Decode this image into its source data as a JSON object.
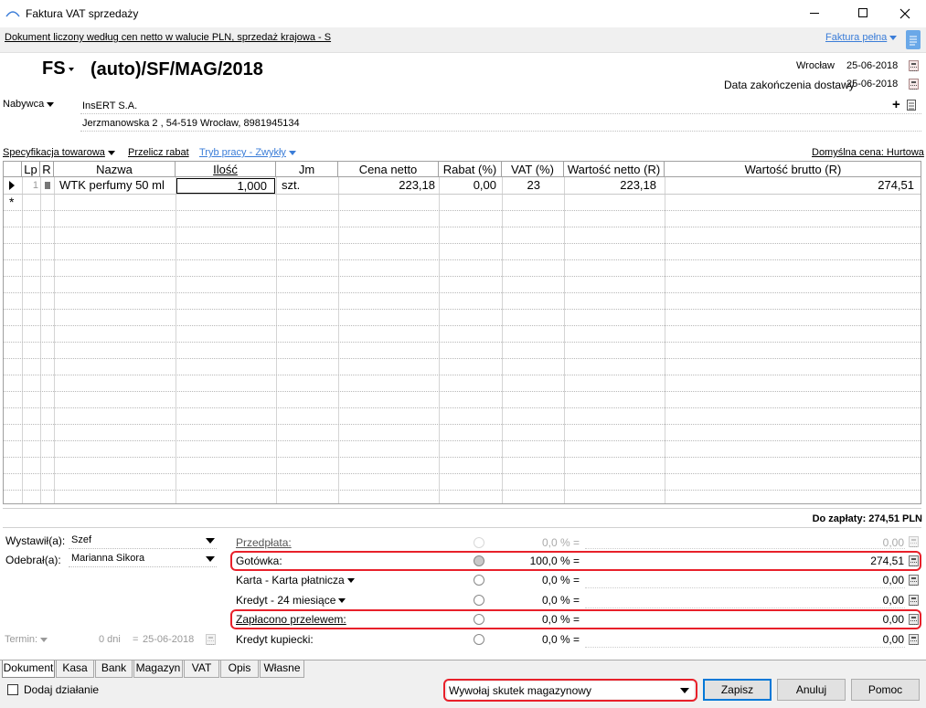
{
  "window": {
    "title": "Faktura VAT sprzedaży",
    "app_icon": "GT"
  },
  "infobar": {
    "text": "Dokument liczony według cen netto w walucie PLN, sprzedaż krajowa - S",
    "type_link": "Faktura pełna"
  },
  "doc": {
    "prefix": "FS",
    "number": "(auto)/SF/MAG/2018"
  },
  "place": {
    "city": "Wrocław",
    "issue_date": "25-06-2018",
    "delivery_label": "Data zakończenia dostawy",
    "delivery_date": "25-06-2018"
  },
  "buyer": {
    "label": "Nabywca",
    "name": "InsERT S.A.",
    "address": "Jerzmanowska 2 , 54-519 Wrocław, 8981945134"
  },
  "toolbar": {
    "spec": "Specyfikacja towarowa",
    "recalc": "Przelicz rabat",
    "mode": "Tryb pracy - Zwykły",
    "default_price": "Domyślna cena: Hurtowa"
  },
  "grid": {
    "headers": [
      "Lp",
      "R",
      "Nazwa",
      "Ilość",
      "Jm",
      "Cena netto",
      "Rabat (%)",
      "VAT (%)",
      "Wartość netto (R)",
      "Wartość brutto (R)"
    ],
    "rows": [
      {
        "lp": "1",
        "name": "WTK perfumy 50 ml",
        "qty": "1,000",
        "unit": "szt.",
        "price": "223,18",
        "discount": "0,00",
        "vat": "23",
        "net": "223,18",
        "gross": "274,51"
      }
    ],
    "new_row_marker": "*"
  },
  "summary": {
    "to_pay": "Do zapłaty: 274,51 PLN"
  },
  "people": {
    "issued_label": "Wystawił(a):",
    "issued_value": "Szef",
    "received_label": "Odebrał(a):",
    "received_value": "Marianna Sikora"
  },
  "term": {
    "label": "Termin:",
    "days": "0 dni",
    "eq": "=",
    "date": "25-06-2018"
  },
  "payments": [
    {
      "label": "Przedpłata:",
      "pct": "0,0 % =",
      "amount": "0,00"
    },
    {
      "label": "Gotówka:",
      "pct": "100,0 % =",
      "amount": "274,51"
    },
    {
      "label": "Karta - Karta płatnicza",
      "pct": "0,0 % =",
      "amount": "0,00"
    },
    {
      "label": "Kredyt - 24 miesiące",
      "pct": "0,0 % =",
      "amount": "0,00"
    },
    {
      "label": "Zapłacono przelewem:",
      "pct": "0,0 % =",
      "amount": "0,00"
    },
    {
      "label": "Kredyt kupiecki:",
      "pct": "0,0 % =",
      "amount": "0,00"
    }
  ],
  "tabs": [
    "Dokument",
    "Kasa",
    "Bank",
    "Magazyn",
    "VAT",
    "Opis",
    "Własne"
  ],
  "footer": {
    "add_action": "Dodaj działanie",
    "stock_effect": "Wywołaj skutek magazynowy",
    "save": "Zapisz",
    "cancel": "Anuluj",
    "help": "Pomoc"
  },
  "colors": {
    "accent": "#3b7dd8",
    "highlight_border": "#e8202a"
  }
}
